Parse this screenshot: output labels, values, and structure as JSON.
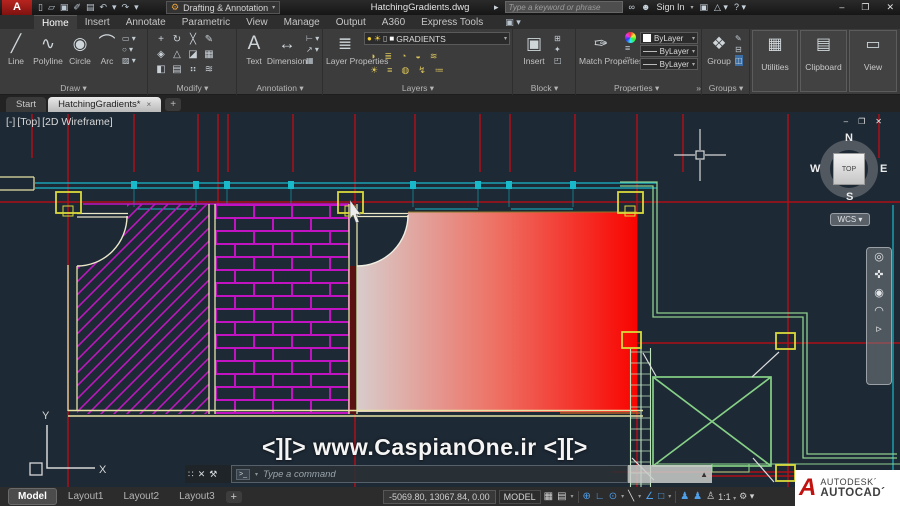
{
  "titlebar": {
    "app_menu": "A",
    "workspace": "Drafting & Annotation",
    "document": "HatchingGradients.dwg",
    "search_placeholder": "Type a keyword or phrase",
    "sign_in": "Sign In"
  },
  "ribbon": {
    "tabs": [
      "Home",
      "Insert",
      "Annotate",
      "Parametric",
      "View",
      "Manage",
      "Output",
      "A360",
      "Express Tools"
    ],
    "active_tab": "Home",
    "draw": {
      "label": "Draw",
      "buttons": [
        "Line",
        "Polyline",
        "Circle",
        "Arc"
      ]
    },
    "modify": {
      "label": "Modify"
    },
    "annotation": {
      "label": "Annotation",
      "text": "Text",
      "dimension": "Dimension"
    },
    "layers": {
      "label": "Layers",
      "layer_properties": "Layer Properties",
      "current_layer": "GRADIENTS"
    },
    "block": {
      "label": "Block",
      "insert": "Insert"
    },
    "properties": {
      "label": "Properties",
      "match_properties": "Match Properties",
      "color": "ByLayer",
      "lineweight": "ByLayer",
      "linetype": "ByLayer"
    },
    "groups": {
      "label": "Groups",
      "group": "Group"
    },
    "utilities": {
      "label": "Utilities"
    },
    "clipboard": {
      "label": "Clipboard"
    },
    "view": {
      "label": "View"
    }
  },
  "file_tabs": {
    "start": "Start",
    "active_doc": "HatchingGradients*",
    "close": "×",
    "new": "+"
  },
  "viewport": {
    "controls": [
      "[-]",
      "[Top]",
      "[2D Wireframe]"
    ]
  },
  "viewcube": {
    "n": "N",
    "s": "S",
    "w": "W",
    "e": "E",
    "face": "TOP",
    "wcs": "WCS ▾"
  },
  "ucs": {
    "x": "X",
    "y": "Y"
  },
  "watermark": "<][> www.CaspianOne.ir <][>",
  "command_line": {
    "prompt": ">_",
    "placeholder": "Type a command",
    "expand": "▲"
  },
  "statusbar": {
    "model_tab": "Model",
    "layouts": [
      "Layout1",
      "Layout2",
      "Layout3"
    ],
    "new_layout": "+",
    "coordinates": "-5069.80, 13067.84, 0.00",
    "model_button": "MODEL",
    "scale": "1:1"
  },
  "logo": {
    "brand": "AUTODESK´",
    "product": "AUTOCAD´"
  },
  "colors": {
    "canvas_bg": "#1d2935",
    "grid_red": "#ad1116",
    "hatch_magenta": "#bb17bb",
    "wall_yellow": "#e6e2a4",
    "column_yellow": "#d9d93c",
    "wall_cyan": "#19b9c9",
    "wall_green": "#8ed08e",
    "gradient_start": "#d8cccb",
    "gradient_end": "#f90400",
    "accent_blue": "#4f9fe8"
  },
  "icons": {
    "qat": [
      "▯",
      "▱",
      "▣",
      "✐",
      "▤",
      "↶",
      "▾",
      "↷",
      "▾"
    ],
    "tab_extra": "▣ ▾",
    "titlebar_right": [
      "∞",
      "☻"
    ],
    "titlebar_far": [
      "▣",
      "△ ▾",
      "? ▾"
    ],
    "window_buttons": [
      "–",
      "❐",
      "✕"
    ],
    "draw_big": [
      "╱",
      "∿",
      "◉",
      "⌒"
    ],
    "draw_small": [
      "▭ ▾",
      "○ ▾",
      "▨ ▾"
    ],
    "modify_grid": [
      "+",
      "↻",
      "╳",
      "✎",
      "◈",
      "△",
      "◪",
      "▦",
      "◧",
      "▤",
      "⠶",
      "≋"
    ],
    "annotation_big": [
      "A",
      "↔"
    ],
    "annotation_small": [
      "⊢ ▾",
      "↗ ▾",
      "▦"
    ],
    "layers_big": "≣",
    "layer_dropdown": [
      "●",
      "☀",
      "▯",
      "■"
    ],
    "layer_rows": [
      [
        "◑",
        "≣",
        "◔",
        "◒",
        "≋"
      ],
      [
        "☀",
        "≡",
        "◍",
        "↯",
        "≔"
      ]
    ],
    "block_big": "▣",
    "block_small": [
      "⊞",
      "✦",
      "◰"
    ],
    "match_big": "✑",
    "prop_col": [
      "≡",
      "┄"
    ],
    "groups_big": "❖",
    "groups_small": [
      "✎",
      "⊟",
      "◫"
    ],
    "utilities_big": "▦",
    "clipboard_big": "▤",
    "view_big": "▭",
    "workspace_gear": "⚙",
    "command": [
      "∷",
      "✕",
      "⚒"
    ],
    "navbar": [
      "◎",
      "✜",
      "◉",
      "◠",
      "▹"
    ],
    "statusbar": [
      {
        "g": "▦",
        "c": "#d0d0d0",
        "d": false
      },
      {
        "g": "▤",
        "c": "#d0d0d0",
        "d": true
      },
      {
        "g": "|",
        "c": "#4a4a4a",
        "d": false
      },
      {
        "g": "⊕",
        "c": "#4f9fe8",
        "d": false
      },
      {
        "g": "∟",
        "c": "#4f9fe8",
        "d": false
      },
      {
        "g": "⊙",
        "c": "#4f9fe8",
        "d": true
      },
      {
        "g": "╲",
        "c": "#d8d8d8",
        "d": true
      },
      {
        "g": "∠",
        "c": "#4f9fe8",
        "d": false
      },
      {
        "g": "□",
        "c": "#4f9fe8",
        "d": true
      },
      {
        "g": "|",
        "c": "#4a4a4a",
        "d": false
      },
      {
        "g": "♟",
        "c": "#4f9fe8",
        "d": false
      },
      {
        "g": "♟",
        "c": "#4f9fe8",
        "d": false
      },
      {
        "g": "♙",
        "c": "#cfcfcf",
        "d": false
      }
    ],
    "scale_dd": "▾",
    "gear": "⚙ ▾"
  }
}
